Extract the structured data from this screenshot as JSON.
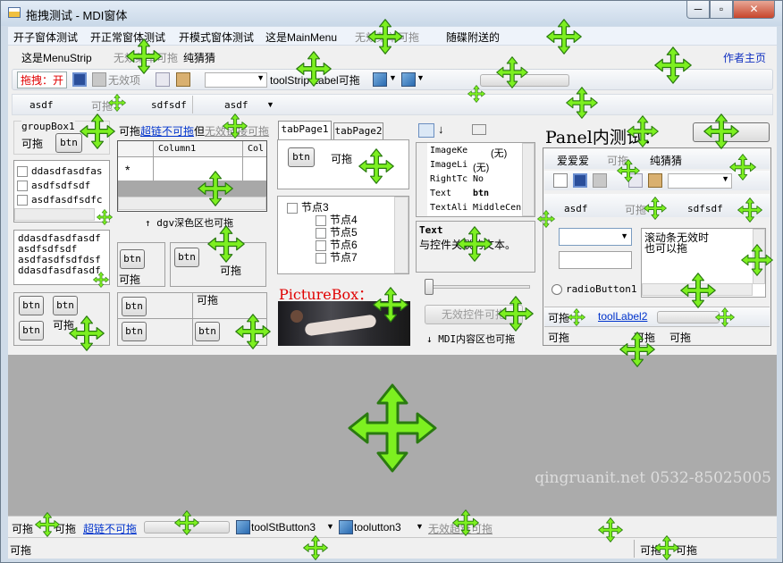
{
  "title": "拖拽测试 - MDI窗体",
  "controls": {
    "minimize": "─",
    "maximize": "▫",
    "close": "✕"
  },
  "menu": [
    "开子窗体测试",
    "开正常窗体测试",
    "开模式窗体测试",
    "这是MainMenu",
    "无效菜单可拖",
    "随碟附送的"
  ],
  "menustrip": {
    "label": "这是MenuStrip",
    "disabled": "无效菜单可拖",
    "pure": "纯猜猜",
    "author": "作者主页"
  },
  "toolbar": {
    "drag_label": "拖拽：开",
    "disabled_item": "无效项",
    "label": "toolStrip Label可拖"
  },
  "strip3": {
    "items": [
      "asdf",
      "可拖",
      "sdfsdf",
      "asdf"
    ]
  },
  "groupbox": {
    "title": "groupBox1",
    "label": "可拖",
    "btn": "btn"
  },
  "links": {
    "drag": "可拖",
    "link": "超链不可拖",
    "but": "但",
    "disabled": "无效链接可拖"
  },
  "grid": {
    "col1": "Column1",
    "col2": "Col",
    "new_row": "*",
    "caption": "↑ dgv深色区也可拖"
  },
  "checklist": {
    "items": [
      "ddasdfasdfas",
      "asdfsdfsdf",
      "asdfasdfsdfc"
    ]
  },
  "listbox": {
    "items": [
      "ddasdfasdfasdf",
      "asdfsdfsdf",
      "asdfasdfsdfdsf",
      "ddasdfasdfasdf"
    ]
  },
  "small_btns": {
    "btn": "btn",
    "drag": "可拖"
  },
  "tabs": {
    "page1": "tabPage1",
    "page2": "tabPage2",
    "btn": "btn",
    "label": "可拖"
  },
  "tree": {
    "root": "节点3",
    "children": [
      "节点4",
      "节点5",
      "节点6",
      "节点7"
    ]
  },
  "picture": {
    "label": "PictureBox："
  },
  "propgrid": {
    "rows": [
      {
        "name": "ImageKe",
        "value": "(无)"
      },
      {
        "name": "ImageLi",
        "value": "(无)"
      },
      {
        "name": "RightTc",
        "value": "No"
      },
      {
        "name": "Text",
        "value": "btn"
      },
      {
        "name": "TextAli",
        "value": "MiddleCen"
      }
    ],
    "desc_title": "Text",
    "desc": "与控件关联的文本。"
  },
  "slider": {
    "disabled_ctrl": "无效控件可拖",
    "mdi_note": "↓ MDI内容区也可拖"
  },
  "right_panel": {
    "title": "Panel内测试：",
    "menu": [
      "爱爱爱",
      "可拖",
      "纯猜猜"
    ],
    "strip": [
      "asdf",
      "可拖",
      "sdfsdf"
    ],
    "scroll_text": "滚动条无效时\n也可以拖",
    "radio": "radioButton1",
    "status": {
      "drag": "可拖",
      "link": "toolLabel2"
    },
    "status2": [
      "可拖",
      "可拖",
      "可拖"
    ]
  },
  "watermark": "qingruanit.net 0532-85025005",
  "statusstrip": {
    "drag": "可拖",
    "drag2": "可拖",
    "link": "超链不可拖",
    "btn3": "toolStButton3",
    "btn4": "toolutton3",
    "disabled": "无效超链可拖"
  },
  "statusbar": {
    "left": "可拖",
    "r1": "可拖",
    "r2": "可拖"
  },
  "colors": {
    "accent": "#7df020",
    "title_bg": "#c9d8e8",
    "mdi_bg": "#ababab",
    "red": "#e00000"
  }
}
